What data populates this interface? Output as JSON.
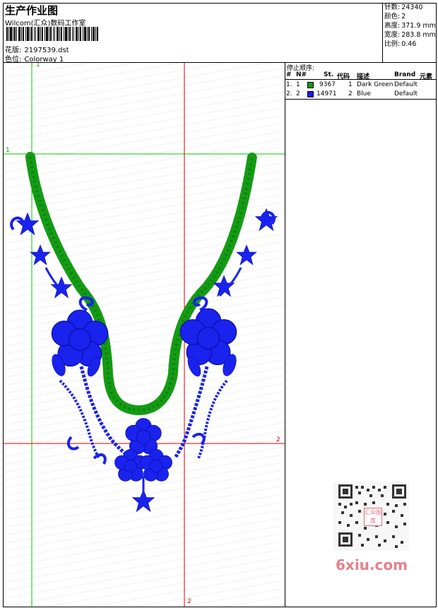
{
  "header": {
    "title": "生产作业图",
    "company": "Wilcom(汇众)数码工作室",
    "design_label": "花版:",
    "design_value": "2197539.dst",
    "colorway_label": "色位:",
    "colorway_value": "Colorway 1"
  },
  "stats": [
    {
      "label": "针数:",
      "value": "24340"
    },
    {
      "label": "颜色:",
      "value": "2"
    },
    {
      "label": "高度:",
      "value": "371.9 mm"
    },
    {
      "label": "宽度:",
      "value": "283.8 mm"
    },
    {
      "label": "比例:",
      "value": "0.46"
    }
  ],
  "stop_sequence": {
    "caption": "停止顺序:",
    "columns": [
      "#",
      "N#",
      "St.",
      "代码",
      "描述",
      "Brand",
      "元素"
    ],
    "rows": [
      {
        "index": "1.",
        "n": "1",
        "color": "#119911",
        "st": "9367",
        "code": "1",
        "desc": "Dark Green",
        "brand": "Default"
      },
      {
        "index": "2.",
        "n": "2",
        "color": "#1a1aee",
        "st": "14971",
        "code": "2",
        "desc": "Blue",
        "brand": "Default"
      }
    ]
  },
  "guides": {
    "green_v": "1",
    "green_h": "1",
    "red_v": "2",
    "red_h": "2"
  },
  "watermark": {
    "qr_label": "汇众图库",
    "site": "6xiu.com"
  },
  "colors": {
    "thread_green": "#149b14",
    "thread_blue": "#1a22ee",
    "guide_green": "#00cc00",
    "guide_red": "#dd0000"
  }
}
